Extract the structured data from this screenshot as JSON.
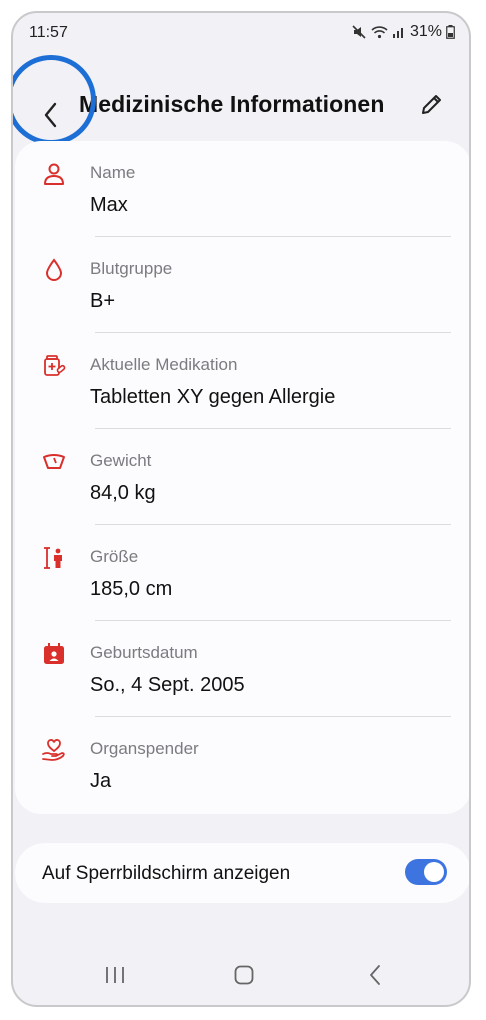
{
  "status_bar": {
    "time": "11:57",
    "battery": "31%",
    "icons": [
      "mute-icon",
      "wifi-icon",
      "signal-icon",
      "battery-icon"
    ]
  },
  "header": {
    "title": "Medizinische Informationen",
    "back_icon": "back-chevron-icon",
    "edit_icon": "pencil-icon"
  },
  "info_items": [
    {
      "icon": "person-icon",
      "label": "Name",
      "value": "Max"
    },
    {
      "icon": "blood-drop-icon",
      "label": "Blutgruppe",
      "value": "B+"
    },
    {
      "icon": "medication-icon",
      "label": "Aktuelle Medikation",
      "value": "Tabletten XY gegen Allergie"
    },
    {
      "icon": "scale-icon",
      "label": "Gewicht",
      "value": "84,0 kg"
    },
    {
      "icon": "height-icon",
      "label": "Größe",
      "value": "185,0 cm"
    },
    {
      "icon": "calendar-icon",
      "label": "Geburtsdatum",
      "value": "So., 4 Sept. 2005"
    },
    {
      "icon": "organ-donor-icon",
      "label": "Organspender",
      "value": "Ja"
    }
  ],
  "lockscreen": {
    "label": "Auf Sperrbildschirm anzeigen",
    "enabled": true
  },
  "nav_bar": {
    "icons": [
      "recents-icon",
      "home-icon",
      "back-icon"
    ]
  },
  "colors": {
    "accent_red": "#d9302c",
    "toggle_blue": "#3e74e0",
    "highlight_ring": "#1d6fd6"
  }
}
